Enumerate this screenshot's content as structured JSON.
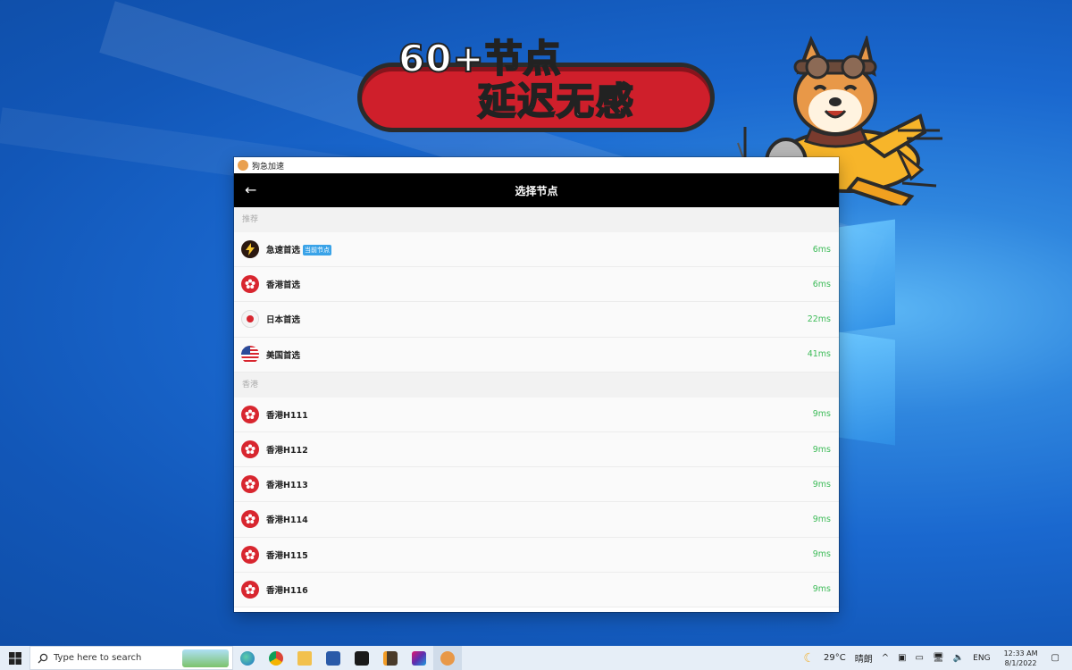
{
  "promo": {
    "line1": "60+节点",
    "line2": "延迟无感"
  },
  "app": {
    "window_title": "狗急加速",
    "header": {
      "back_icon": "←",
      "title": "选择节点"
    },
    "sections": [
      {
        "label": "推荐",
        "rows": [
          {
            "icon": "bolt-icon",
            "name": "急速首选",
            "badge": "当前节点",
            "latency": "6ms"
          },
          {
            "icon": "hk-flag-icon",
            "name": "香港首选",
            "badge": "",
            "latency": "6ms"
          },
          {
            "icon": "jp-flag-icon",
            "name": "日本首选",
            "badge": "",
            "latency": "22ms"
          },
          {
            "icon": "us-flag-icon",
            "name": "美国首选",
            "badge": "",
            "latency": "41ms"
          }
        ]
      },
      {
        "label": "香港",
        "rows": [
          {
            "icon": "hk-flag-icon",
            "name": "香港H111",
            "badge": "",
            "latency": "9ms"
          },
          {
            "icon": "hk-flag-icon",
            "name": "香港H112",
            "badge": "",
            "latency": "9ms"
          },
          {
            "icon": "hk-flag-icon",
            "name": "香港H113",
            "badge": "",
            "latency": "9ms"
          },
          {
            "icon": "hk-flag-icon",
            "name": "香港H114",
            "badge": "",
            "latency": "9ms"
          },
          {
            "icon": "hk-flag-icon",
            "name": "香港H115",
            "badge": "",
            "latency": "9ms"
          },
          {
            "icon": "hk-flag-icon",
            "name": "香港H116",
            "badge": "",
            "latency": "9ms"
          }
        ]
      }
    ],
    "colors": {
      "latency": "#3dbb58",
      "badge": "#3aa3e8",
      "header": "#000000"
    }
  },
  "taskbar": {
    "search_placeholder": "Type here to search",
    "weather_temp": "29°C",
    "weather_text": "晴朗",
    "lang": "ENG",
    "time": "12:33 AM",
    "date": "8/1/2022"
  }
}
